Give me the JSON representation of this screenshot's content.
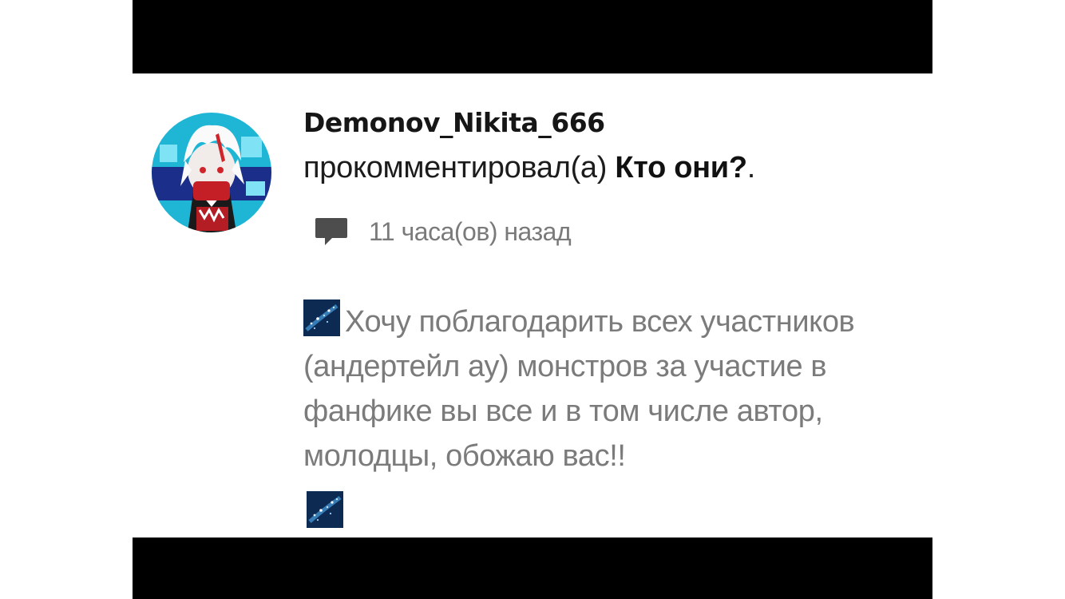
{
  "comment": {
    "username": "Demonov_Nikita_666",
    "action_text": "прокомментировал(а) ",
    "post_title": "Кто они?",
    "post_title_suffix": ".",
    "time_ago": "11 часа(ов) назад",
    "body_text": "Хочу поблагодарить всех участников (андертейл ау) монстров за участие в фанфике вы все и в том числе автор, молодцы, обожаю вас!!",
    "icons": {
      "avatar": "user-avatar",
      "comment": "comment-bubble-icon",
      "sticker": "starry-sky-sticker"
    }
  },
  "colors": {
    "letterbox": "#000000",
    "background": "#ffffff",
    "username": "#161616",
    "body_text": "#7b7b7b",
    "time_text": "#7a7a7a",
    "icon_gray": "#4d4d4d",
    "sticker_bg": "#0c2a52"
  }
}
